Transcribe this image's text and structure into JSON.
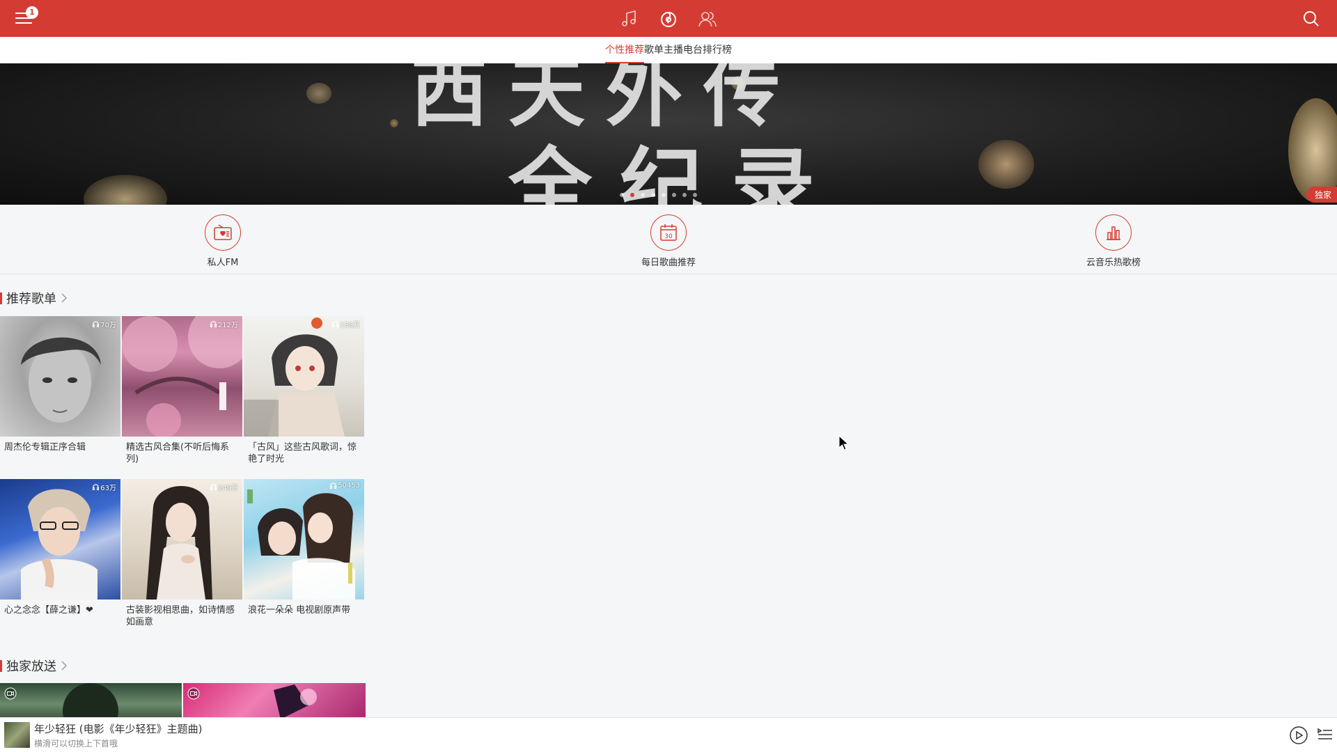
{
  "topbar": {
    "notification_count": "1",
    "accent": "#d43c33"
  },
  "tabs": [
    {
      "label": "个性推荐",
      "active": true
    },
    {
      "label": "歌单",
      "active": false
    },
    {
      "label": "主播电台",
      "active": false
    },
    {
      "label": "排行榜",
      "active": false
    }
  ],
  "banner": {
    "line1": "西天外传",
    "line2": "全纪录",
    "badge": "独家",
    "slide_count": 8,
    "active_slide": 2
  },
  "quick_entries": [
    {
      "label": "私人FM",
      "icon": "radio-heart-icon"
    },
    {
      "label": "每日歌曲推荐",
      "icon": "calendar-30-icon"
    },
    {
      "label": "云音乐热歌榜",
      "icon": "bar-chart-icon"
    }
  ],
  "recommended": {
    "title": "推荐歌单",
    "playlists": [
      {
        "title": "周杰伦专辑正序合辑",
        "plays": "70万"
      },
      {
        "title": "精选古风合集(不听后悔系列)",
        "plays": "212万"
      },
      {
        "title": "「古风」这些古风歌词，惊艳了时光",
        "plays": "158万"
      },
      {
        "title": "心之念念【薛之谦】❤",
        "plays": "63万"
      },
      {
        "title": "古装影视相思曲，如诗情感如画意",
        "plays": "249万"
      },
      {
        "title": "浪花一朵朵 电视剧原声带",
        "plays": "50453"
      }
    ]
  },
  "exclusive": {
    "title": "独家放送"
  },
  "player": {
    "title": "年少轻狂 (电影《年少轻狂》主题曲)",
    "subtitle": "横滑可以切换上下首哦"
  }
}
